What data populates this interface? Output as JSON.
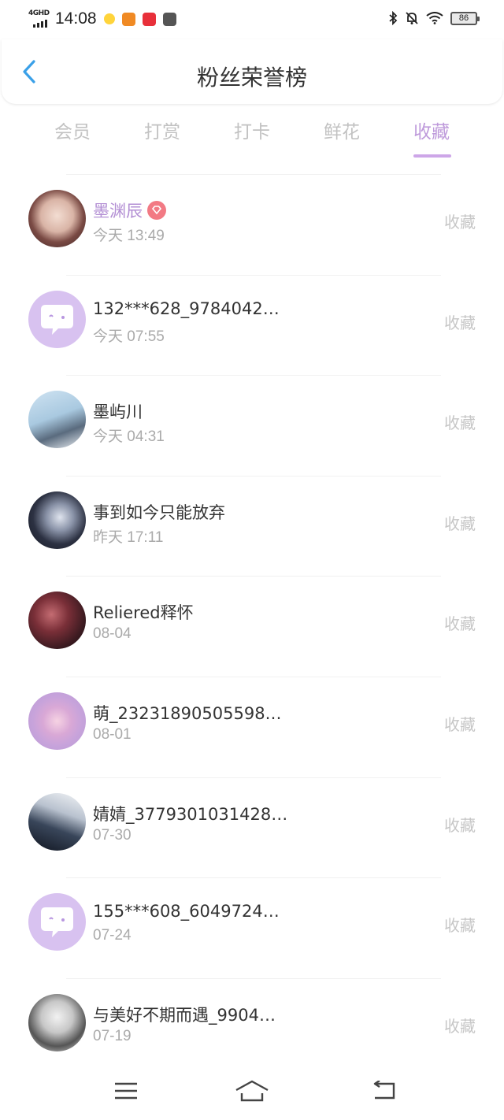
{
  "status_bar": {
    "network": "4GHD",
    "time": "14:08",
    "battery": "86"
  },
  "header": {
    "title": "粉丝荣誉榜",
    "back_icon": "chevron-left-icon"
  },
  "tabs": [
    {
      "label": "会员",
      "active": false
    },
    {
      "label": "打赏",
      "active": false
    },
    {
      "label": "打卡",
      "active": false
    },
    {
      "label": "鲜花",
      "active": false
    },
    {
      "label": "收藏",
      "active": true
    }
  ],
  "colors": {
    "accent": "#bf9bdb",
    "back": "#3aa0e8",
    "default_avatar_bg": "#d8c2f0"
  },
  "list": [
    {
      "name": "墨渊辰",
      "time": "今天 13:49",
      "action": "收藏",
      "vip": true,
      "avatar": "photo-1"
    },
    {
      "name": "132***628_9784042…",
      "time": "今天 07:55",
      "action": "收藏",
      "vip": false,
      "avatar": "default"
    },
    {
      "name": "墨屿川",
      "time": "今天 04:31",
      "action": "收藏",
      "vip": false,
      "avatar": "photo-2"
    },
    {
      "name": "事到如今只能放弃",
      "time": "昨天 17:11",
      "action": "收藏",
      "vip": false,
      "avatar": "photo-3"
    },
    {
      "name": "Reliered释怀",
      "time": "08-04",
      "action": "收藏",
      "vip": false,
      "avatar": "photo-4"
    },
    {
      "name": "萌_23231890505598…",
      "time": "08-01",
      "action": "收藏",
      "vip": false,
      "avatar": "photo-5"
    },
    {
      "name": "婧婧_3779301031428…",
      "time": "07-30",
      "action": "收藏",
      "vip": false,
      "avatar": "photo-6"
    },
    {
      "name": "155***608_6049724…",
      "time": "07-24",
      "action": "收藏",
      "vip": false,
      "avatar": "default"
    },
    {
      "name": "与美好不期而遇_9904…",
      "time": "07-19",
      "action": "收藏",
      "vip": false,
      "avatar": "photo-7"
    }
  ],
  "bottom_nav": [
    "menu-icon",
    "home-icon",
    "back-icon"
  ]
}
